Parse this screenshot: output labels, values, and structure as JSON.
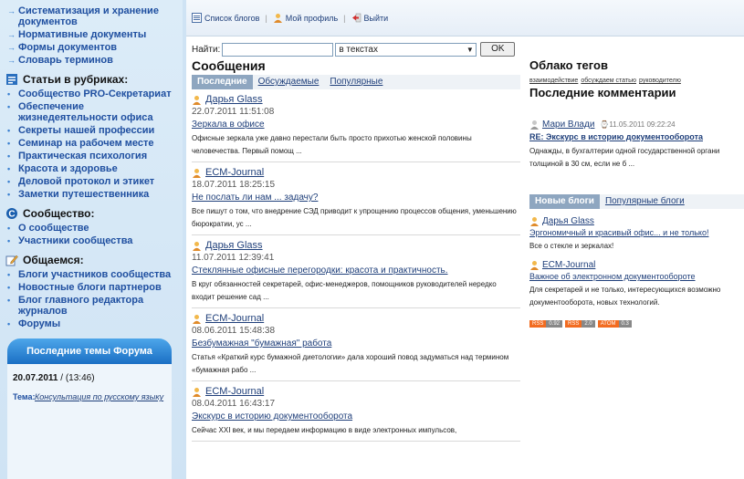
{
  "sidebar": {
    "top_links": [
      "Систематизация и хранение документов",
      "Нормативные документы",
      "Формы документов",
      "Словарь терминов"
    ],
    "rubrics_title": "Статьи в рубриках:",
    "rubrics": [
      "Сообщество PRO-Секретариат",
      "Обеспечение жизнедеятельности офиса",
      "Секреты нашей профессии",
      "Семинар на рабочем месте",
      "Практическая психология",
      "Красота и здоровье",
      "Деловой протокол и этикет",
      "Заметки путешественника"
    ],
    "community_title": "Сообщество:",
    "community": [
      "О сообществе",
      "Участники сообщества"
    ],
    "talk_title": "Общаемся:",
    "talk": [
      "Блоги участников сообщества",
      "Новостные блоги партнеров",
      "Блог главного редактора журналов",
      "Форумы"
    ],
    "forum_header": "Последние темы Форума",
    "forum_date": "20.07.2011",
    "forum_time": "/ (13:46)",
    "forum_topic_label": "Тема:",
    "forum_topic": "Консультация по русскому языку"
  },
  "toolbar": {
    "blogs": "Список блогов",
    "profile": "Мой профиль",
    "logout": "Выйти"
  },
  "search": {
    "label": "Найти:",
    "value": "",
    "scope": "в текстах",
    "button": "OK"
  },
  "messages": {
    "title": "Сообщения",
    "tabs": [
      "Последние",
      "Обсуждаемые",
      "Популярные"
    ],
    "posts": [
      {
        "author": "Дарья Glass",
        "date": "22.07.2011 11:51:08",
        "title": "Зеркала в офисе",
        "excerpt": "Офисные зеркала уже давно перестали быть просто прихотью женской половины человечества. Первый помощ ..."
      },
      {
        "author": "ECM-Journal",
        "date": "18.07.2011 18:25:15",
        "title": "Не послать ли нам ... задачу?",
        "excerpt": "Все пишут о том, что внедрение СЭД приводит к упрощению процессов общения, уменьшению бюрократии, ус ..."
      },
      {
        "author": "Дарья Glass",
        "date": "11.07.2011 12:39:41",
        "title": "Стеклянные офисные перегородки: красота и практичность.",
        "excerpt": "В круг обязанностей секретарей, офис-менеджеров, помощников руководителей нередко входит решение сад ..."
      },
      {
        "author": "ECM-Journal",
        "date": "08.06.2011 15:48:38",
        "title": "Безбумажная \"бумажная\" работа",
        "excerpt": "Статья «Краткий курс бумажной диетологии» дала хороший повод задуматься над термином «бумажная рабо ..."
      },
      {
        "author": "ECM-Journal",
        "date": "08.04.2011 16:43:17",
        "title": "Экскурс в историю документооборота",
        "excerpt": "Сейчас XXI век, и мы передаем информацию в виде электронных импульсов,"
      }
    ]
  },
  "tag_cloud": {
    "title": "Облако тегов",
    "tags": [
      "взаимодействие",
      "обсуждаем статью",
      "руководителю"
    ]
  },
  "comments": {
    "title": "Последние комментарии",
    "author": "Мари Влади",
    "time": "11.05.2011 09:22:24",
    "post_title": "RE: Экскурс в историю документооборота",
    "excerpt": "Однажды, в бухгалтерии одной государственной органи толщиной в 30 см, если не б ..."
  },
  "blogs": {
    "tabs": [
      "Новые блоги",
      "Популярные блоги"
    ],
    "items": [
      {
        "author": "Дарья Glass",
        "title": "Эргономичный и красивый офис... и не только!",
        "excerpt": "Все о стекле и зеркалах!"
      },
      {
        "author": "ECM-Journal",
        "title": "Важное об электронном документообороте",
        "excerpt": "Для секретарей и не только, интересующихся возможно документооборота, новых технологий."
      }
    ]
  },
  "feeds": [
    {
      "k": "RSS",
      "v": "0.92"
    },
    {
      "k": "RSS",
      "v": "2.0"
    },
    {
      "k": "ATOM",
      "v": "0.3"
    }
  ],
  "colors": {
    "accent": "#1f4fa0",
    "tab_active": "#8ea6c0",
    "forum_tab": "#2b86d8",
    "badge": "#f26c21"
  }
}
